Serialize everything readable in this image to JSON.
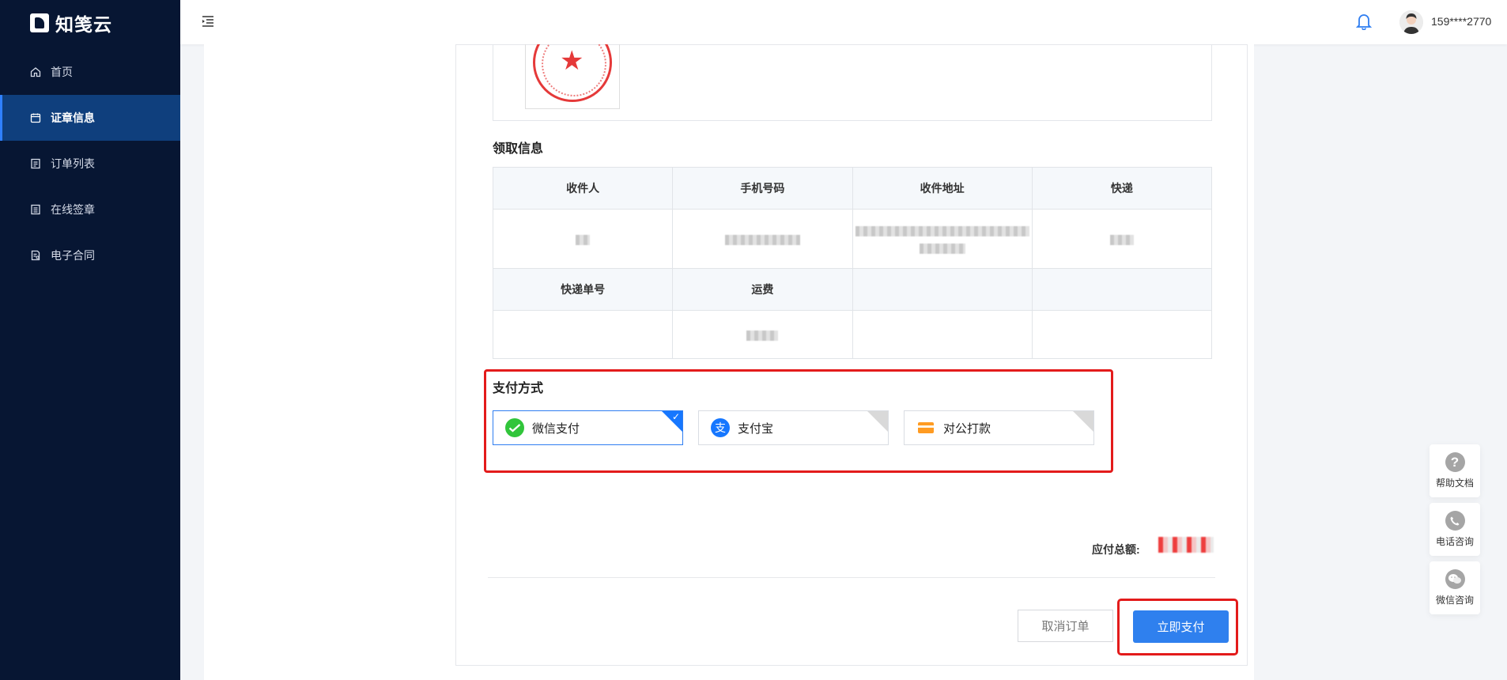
{
  "brand": {
    "name": "知笺云"
  },
  "sidebar": {
    "items": [
      {
        "label": "首页",
        "icon": "home-icon"
      },
      {
        "label": "证章信息",
        "icon": "calendar-icon",
        "active": true
      },
      {
        "label": "订单列表",
        "icon": "list-icon"
      },
      {
        "label": "在线签章",
        "icon": "sign-icon"
      },
      {
        "label": "电子合同",
        "icon": "contract-icon"
      }
    ]
  },
  "header": {
    "user": "159****2770"
  },
  "receipt": {
    "title": "领取信息",
    "headers1": [
      "收件人",
      "手机号码",
      "收件地址",
      "快递"
    ],
    "headers2": [
      "快递单号",
      "运费",
      "",
      ""
    ]
  },
  "payment": {
    "title": "支付方式",
    "options": [
      {
        "label": "微信支付",
        "icon": "wechat-pay-icon",
        "selected": true
      },
      {
        "label": "支付宝",
        "icon": "alipay-icon",
        "selected": false
      },
      {
        "label": "对公打款",
        "icon": "bank-transfer-icon",
        "selected": false
      }
    ]
  },
  "summary": {
    "total_label": "应付总额:"
  },
  "actions": {
    "cancel": "取消订单",
    "pay": "立即支付"
  },
  "tools": [
    {
      "label": "帮助文档",
      "icon": "help-icon"
    },
    {
      "label": "电话咨询",
      "icon": "phone-icon"
    },
    {
      "label": "微信咨询",
      "icon": "wechat-icon"
    }
  ],
  "colors": {
    "sidebar": "#071633",
    "sidebar_active": "#0f3f7d",
    "primary": "#2f80ee",
    "highlight_outline": "#e31b1b"
  }
}
